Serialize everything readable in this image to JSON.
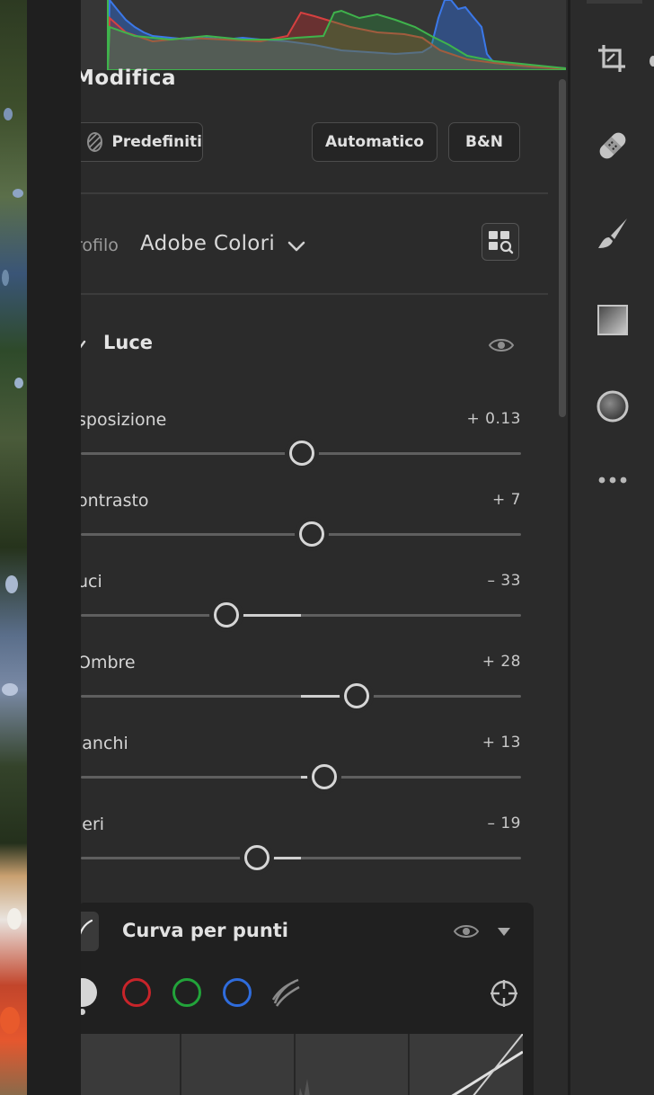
{
  "edit_panel": {
    "title": "Modifica",
    "buttons": {
      "presets": "Predefiniti",
      "auto": "Automatico",
      "bw": "B&N"
    },
    "profile": {
      "label": "rofilo",
      "value": "Adobe Colori"
    },
    "light": {
      "title": "Luce",
      "sliders": [
        {
          "label": "sposizione",
          "value": "+ 0.13",
          "position": 0.503
        },
        {
          "label": "ontrasto",
          "value": "+ 7",
          "position": 0.524
        },
        {
          "label": "uci",
          "value": "– 33",
          "position": 0.33
        },
        {
          "label": "Ombre",
          "value": "+ 28",
          "position": 0.627
        },
        {
          "label": "ianchi",
          "value": "+ 13",
          "position": 0.553
        },
        {
          "label": "leri",
          "value": "– 19",
          "position": 0.4
        }
      ]
    },
    "point_curve": {
      "title": "Curva per punti",
      "channels": [
        "rgb-channel-icon",
        "red-channel-icon",
        "green-channel-icon",
        "blue-channel-icon",
        "parametric-curve-icon"
      ]
    }
  },
  "toolbar": {
    "icons": [
      "crop-icon",
      "healing-icon",
      "brush-icon",
      "linear-gradient-icon",
      "radial-gradient-icon",
      "more-icon"
    ]
  },
  "colors": {
    "panel_bg": "#2b2b2b",
    "red": "#c8242a",
    "green": "#22a33a",
    "blue": "#2f6cdc"
  }
}
